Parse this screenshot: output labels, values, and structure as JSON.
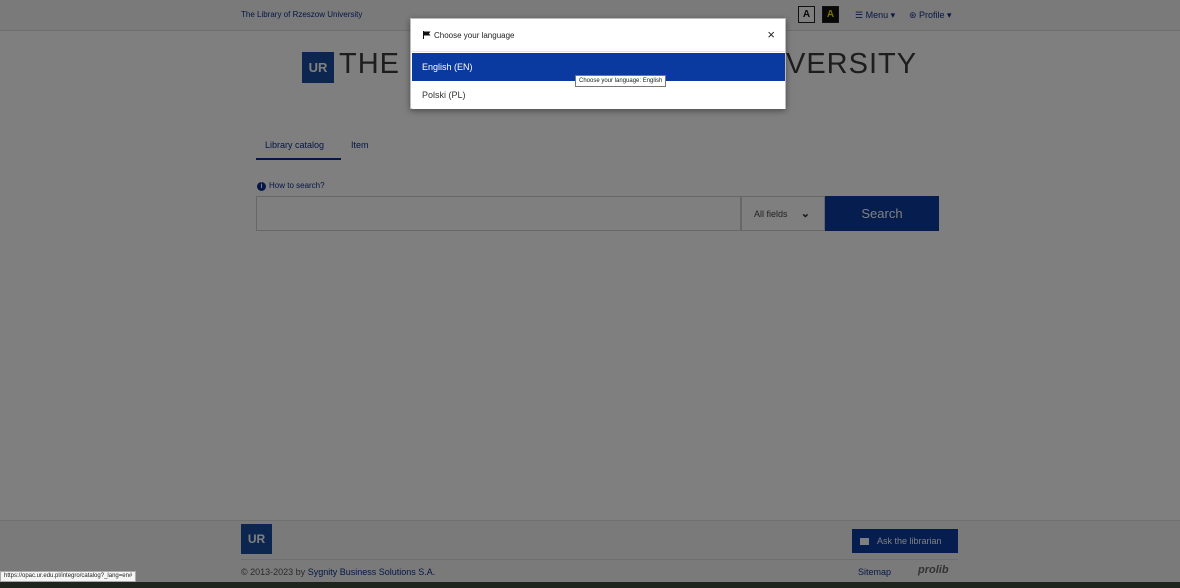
{
  "topbar": {
    "library_name": "The Library of Rzeszow University",
    "contrast_normal": "A",
    "contrast_high": "A",
    "menu_label": "☰ Menu ▾",
    "profile_label": "⊛ Profile ▾"
  },
  "header": {
    "logo_text": "UR",
    "title_left": "THE L",
    "title_right": "VERSITY"
  },
  "tabs": [
    "Library catalog",
    "Item"
  ],
  "search": {
    "howto_label": "How to search?",
    "input_value": "",
    "field_selected": "All fields",
    "button_label": "Search"
  },
  "footer": {
    "logo_text": "UR",
    "ask_label": "Ask the librarian",
    "copyright_prefix": "© 2013-2023 by ",
    "copyright_company": "Sygnity Business Solutions S.A.",
    "sitemap_label": "Sitemap",
    "prolib_label": "prolib"
  },
  "modal": {
    "title": "Choose your language",
    "close_label": "×",
    "options": [
      "English (EN)",
      "Polski (PL)"
    ],
    "tooltip": "Choose your language: English"
  },
  "status_bar": {
    "url": "https://opac.ur.edu.pl/integro/catalog?_lang=en#"
  },
  "colors": {
    "accent": "#0a3a9f",
    "link": "#0a2f8f",
    "logo": "#1a4c9e"
  }
}
